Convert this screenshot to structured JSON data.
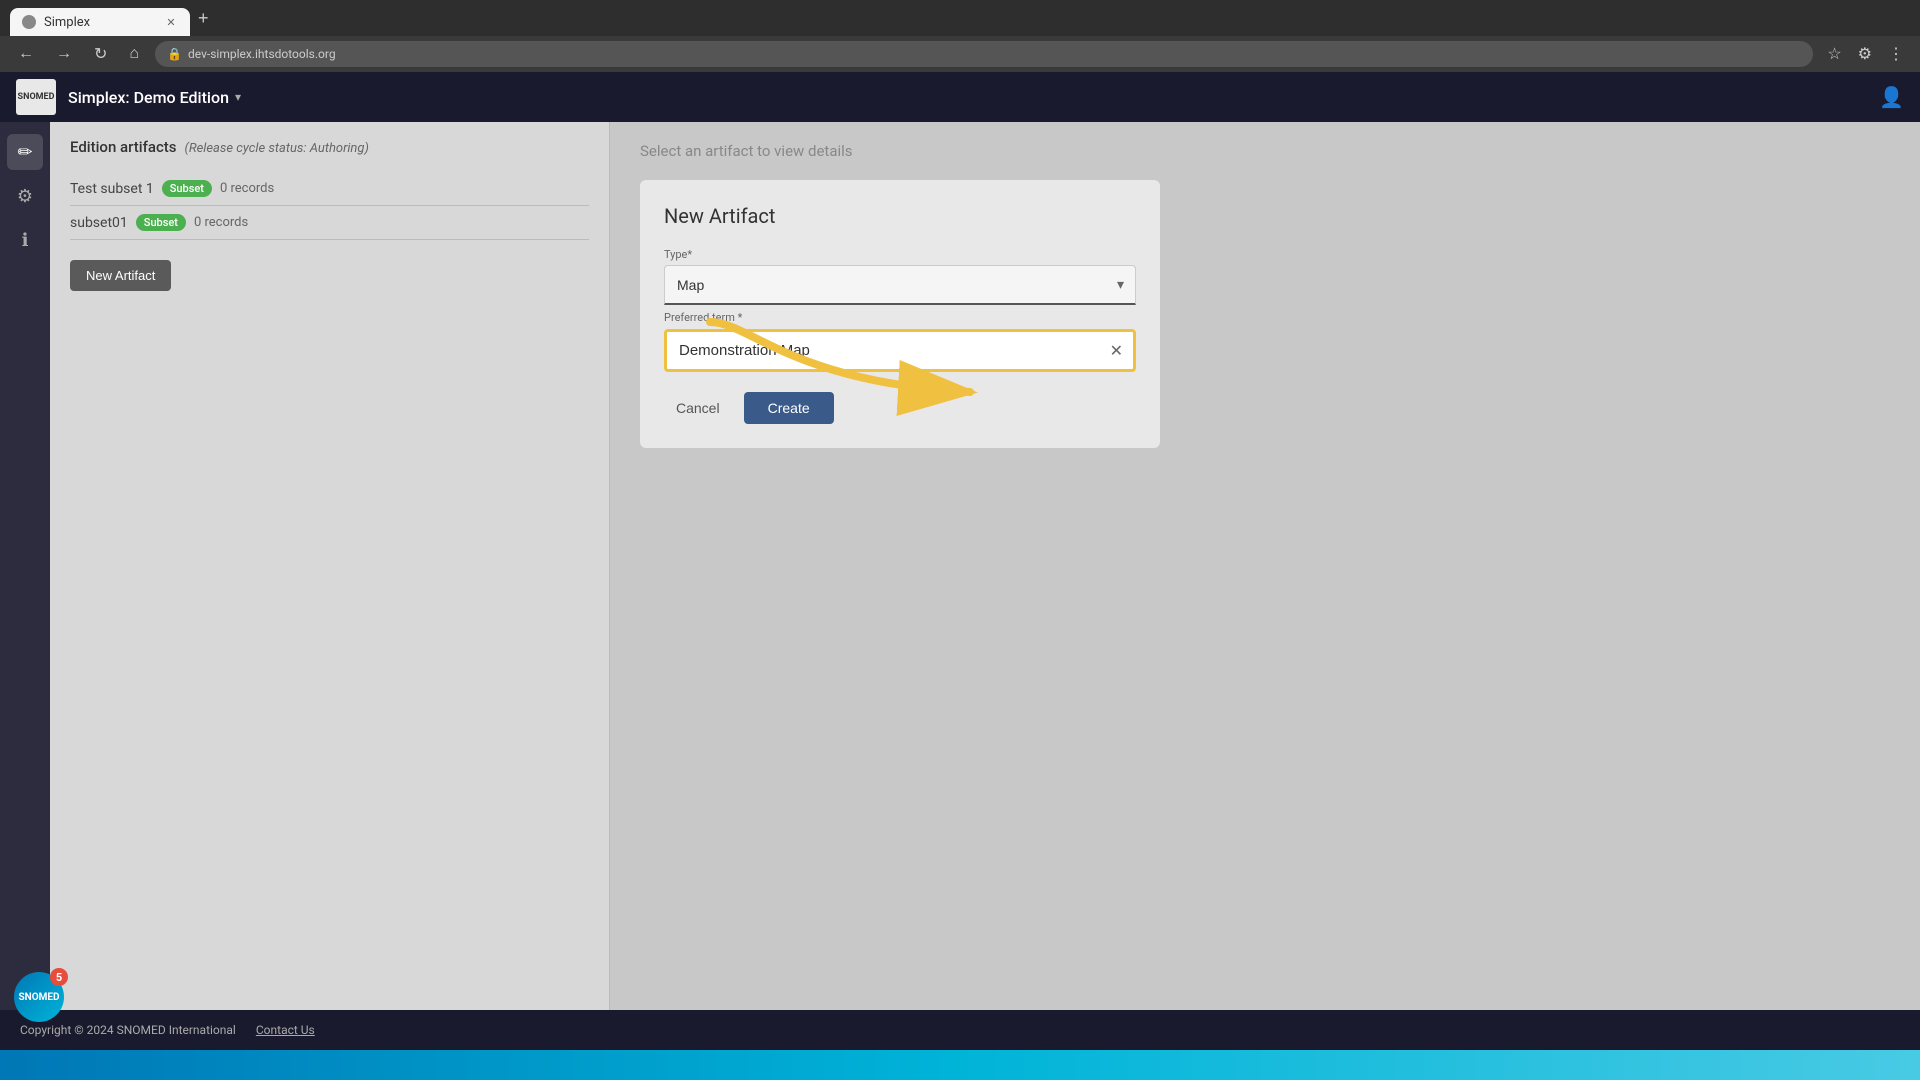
{
  "browser": {
    "tab_label": "Simplex",
    "url": "dev-simplex.ihtsdotools.org",
    "new_tab_icon": "+",
    "back_icon": "←",
    "forward_icon": "→",
    "refresh_icon": "↻",
    "home_icon": "⌂"
  },
  "app": {
    "logo_text": "SNOMED",
    "title": "Simplex: Demo Edition",
    "title_chevron": "▾",
    "user_icon": "👤"
  },
  "sidebar": {
    "icons": [
      {
        "name": "edit-icon",
        "symbol": "✏",
        "active": true
      },
      {
        "name": "settings-icon",
        "symbol": "⚙",
        "active": false
      },
      {
        "name": "info-icon",
        "symbol": "ℹ",
        "active": false
      }
    ]
  },
  "left_panel": {
    "title": "Edition artifacts",
    "status": "(Release cycle status: Authoring)",
    "artifacts": [
      {
        "name": "Test subset 1",
        "badge": "Subset",
        "records": "0 records"
      },
      {
        "name": "subset01",
        "badge": "Subset",
        "records": "0 records"
      }
    ],
    "new_artifact_button": "New Artifact"
  },
  "right_panel": {
    "hint": "Select an artifact to view details",
    "new_artifact_title": "New Artifact",
    "type_label": "Type*",
    "type_value": "Map",
    "preferred_term_label": "Preferred term *",
    "preferred_term_value": "Demonstration Map",
    "cancel_label": "Cancel",
    "create_label": "Create"
  },
  "snomed_avatar": {
    "text": "SNOMED",
    "badge": "5"
  },
  "footer": {
    "copyright": "Copyright © 2024 SNOMED International",
    "contact_us": "Contact Us"
  }
}
